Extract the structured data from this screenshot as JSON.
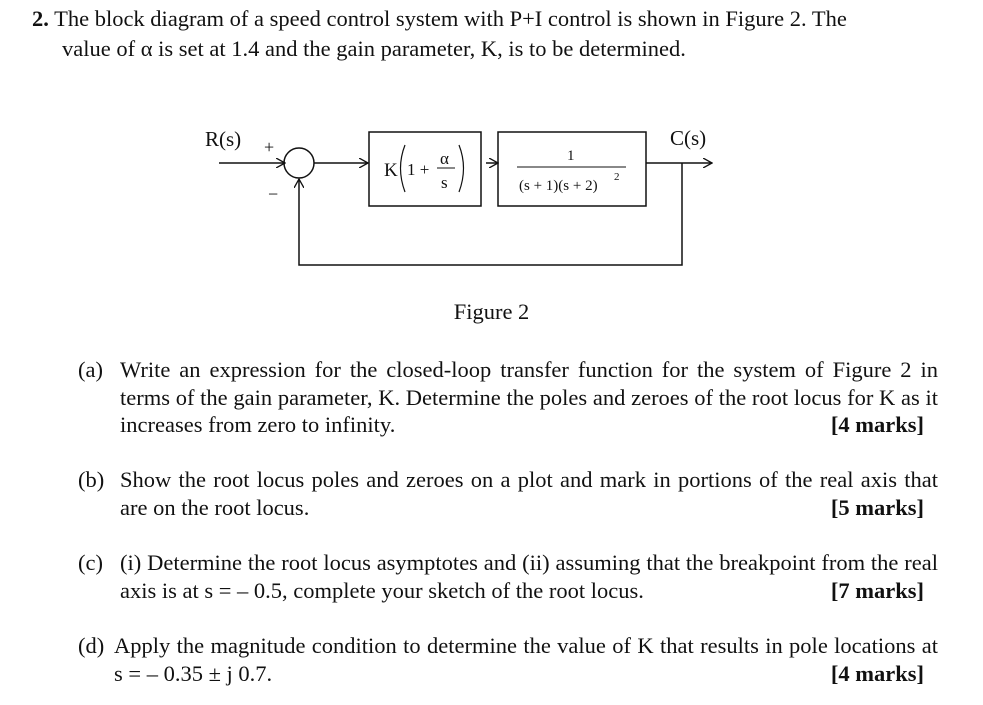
{
  "question": {
    "number": "2.",
    "intro_line1": "The block diagram of a speed control system with P+I control is shown in Figure 2. The",
    "intro_line2": "value of α is set at 1.4 and the gain parameter, K, is to be determined."
  },
  "diagram": {
    "input_label": "R(s)",
    "output_label": "C(s)",
    "plus_sign": "+",
    "minus_sign": "−",
    "controller": {
      "gain": "K",
      "one_plus": "1 +",
      "numerator": "α",
      "denominator": "s"
    },
    "plant": {
      "numerator": "1",
      "denominator": "(s + 1)(s + 2)",
      "exponent": "2"
    },
    "caption": "Figure 2"
  },
  "parts": [
    {
      "label": "(a)",
      "text": "Write an expression for the closed-loop transfer function for the system of Figure 2 in terms of the gain parameter, K. Determine the poles and zeroes of the root locus for K as it increases from zero to infinity.",
      "marks": "[4 marks]"
    },
    {
      "label": "(b)",
      "text": "Show the root locus poles and zeroes on a plot and mark in portions of the real axis that are on the root locus.",
      "marks": "[5 marks]"
    },
    {
      "label": "(c)",
      "text": "(i) Determine the root locus asymptotes and (ii) assuming that the breakpoint from the real axis is at s = – 0.5, complete your sketch of the root locus.",
      "marks": "[7 marks]"
    },
    {
      "label": "(d)",
      "text": "Apply the magnitude condition to determine the value of K that results in pole locations at s = – 0.35 ± j 0.7.",
      "marks": "[4 marks]"
    }
  ]
}
